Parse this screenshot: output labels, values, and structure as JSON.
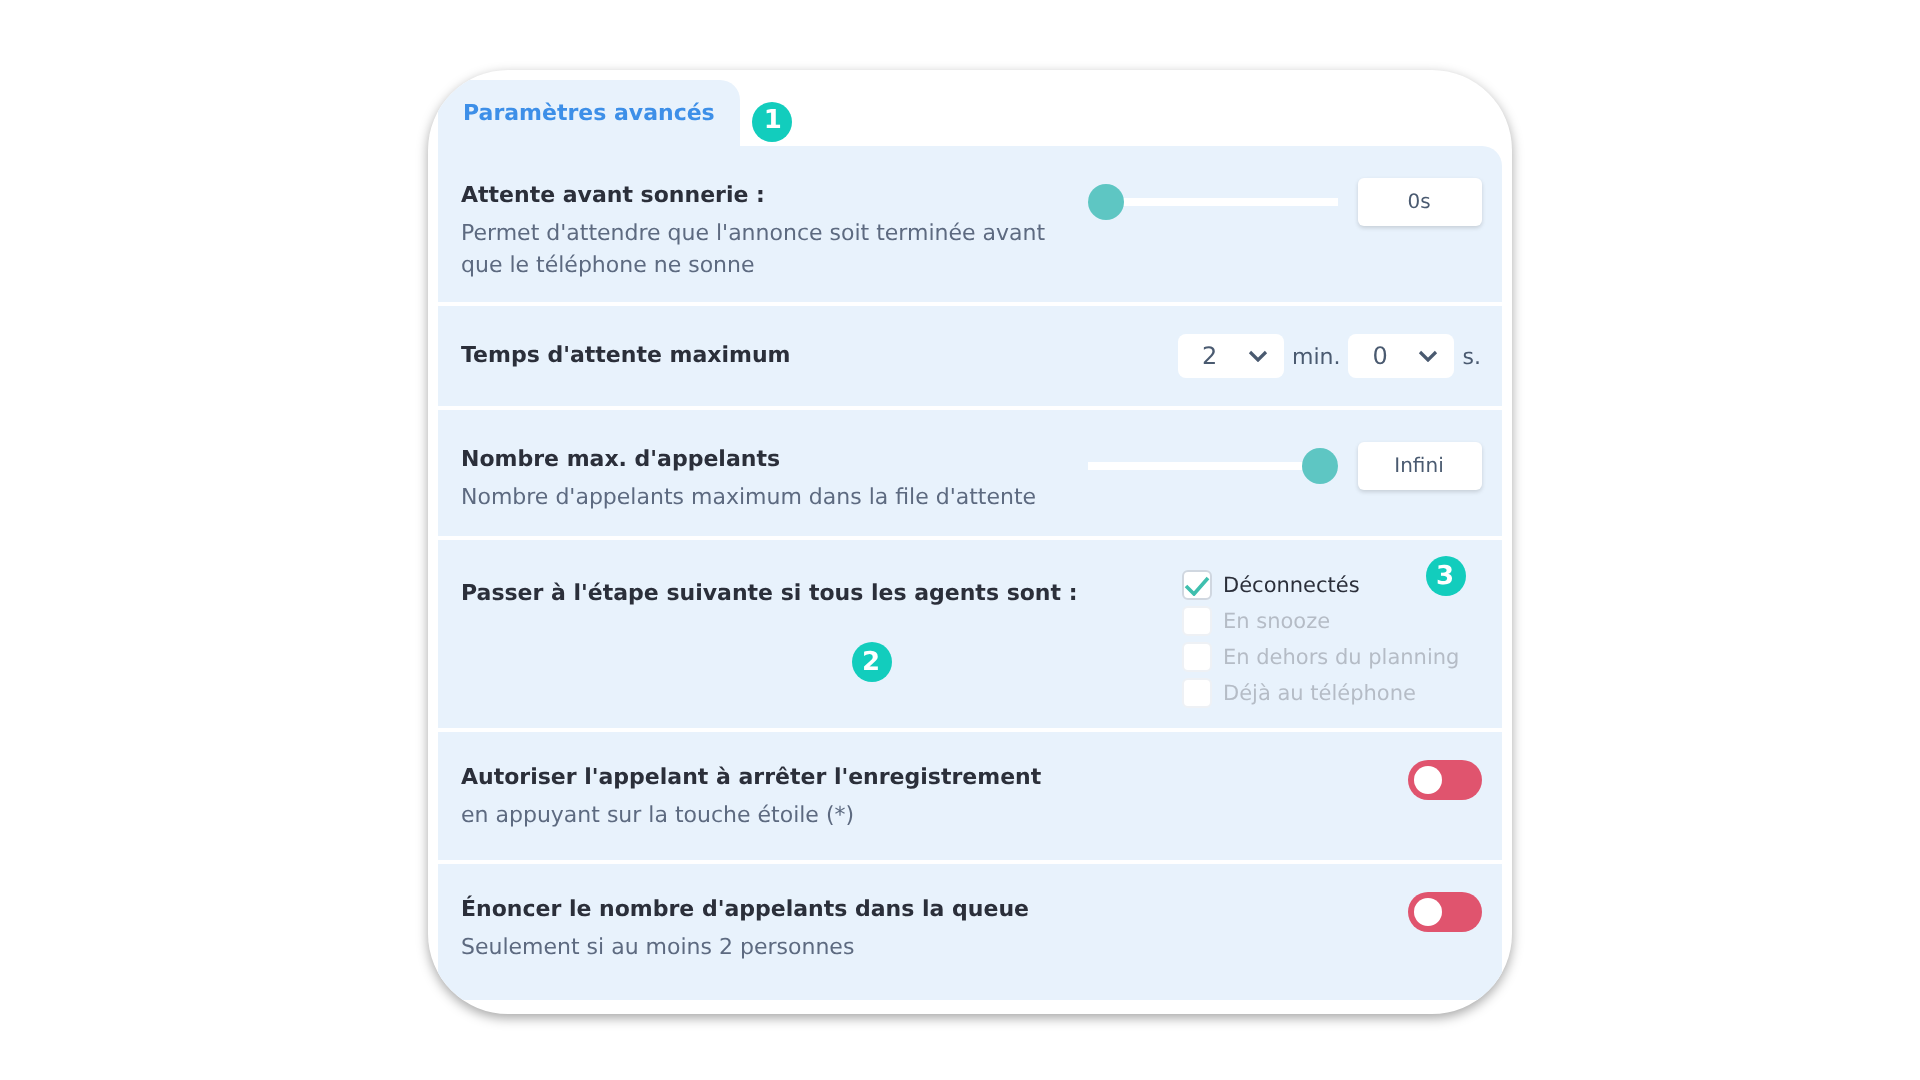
{
  "tab": {
    "label": "Paramètres avancés",
    "selected": true,
    "badge": "1"
  },
  "rows": [
    {
      "kind": "slider",
      "title": "Attente avant sonnerie :",
      "description": "Permet d'attendre que l'annonce soit terminée avant que le téléphone ne sonne",
      "level": 0,
      "value": "0s"
    },
    {
      "kind": "duration",
      "title": "Temps d'attente maximum",
      "minutes": "2",
      "minutes_unit": "min.",
      "seconds": "0",
      "seconds_unit": "s."
    },
    {
      "kind": "slider",
      "title": "Nombre max. d'appelants",
      "description": "Nombre d'appelants maximum dans la file d'attente",
      "level": 1,
      "value": "Infini"
    },
    {
      "kind": "checklist",
      "title": "Passer à l'étape suivante si tous les agents sont :",
      "title_badge": "2",
      "options_badge": "3",
      "options": [
        {
          "label": "Déconnectés",
          "checked": true,
          "disabled": false
        },
        {
          "label": "En snooze",
          "checked": false,
          "disabled": true
        },
        {
          "label": "En dehors du planning",
          "checked": false,
          "disabled": true
        },
        {
          "label": "Déjà au téléphone",
          "checked": false,
          "disabled": true
        }
      ]
    },
    {
      "kind": "toggle",
      "title": "Autoriser l'appelant à arrêter l'enregistrement",
      "description": "en appuyant sur la touche étoile (*)",
      "on": false
    },
    {
      "kind": "toggle",
      "title": "Énoncer le nombre d'appelants dans la queue",
      "description": "Seulement si au moins 2 personnes",
      "on": false
    }
  ]
}
